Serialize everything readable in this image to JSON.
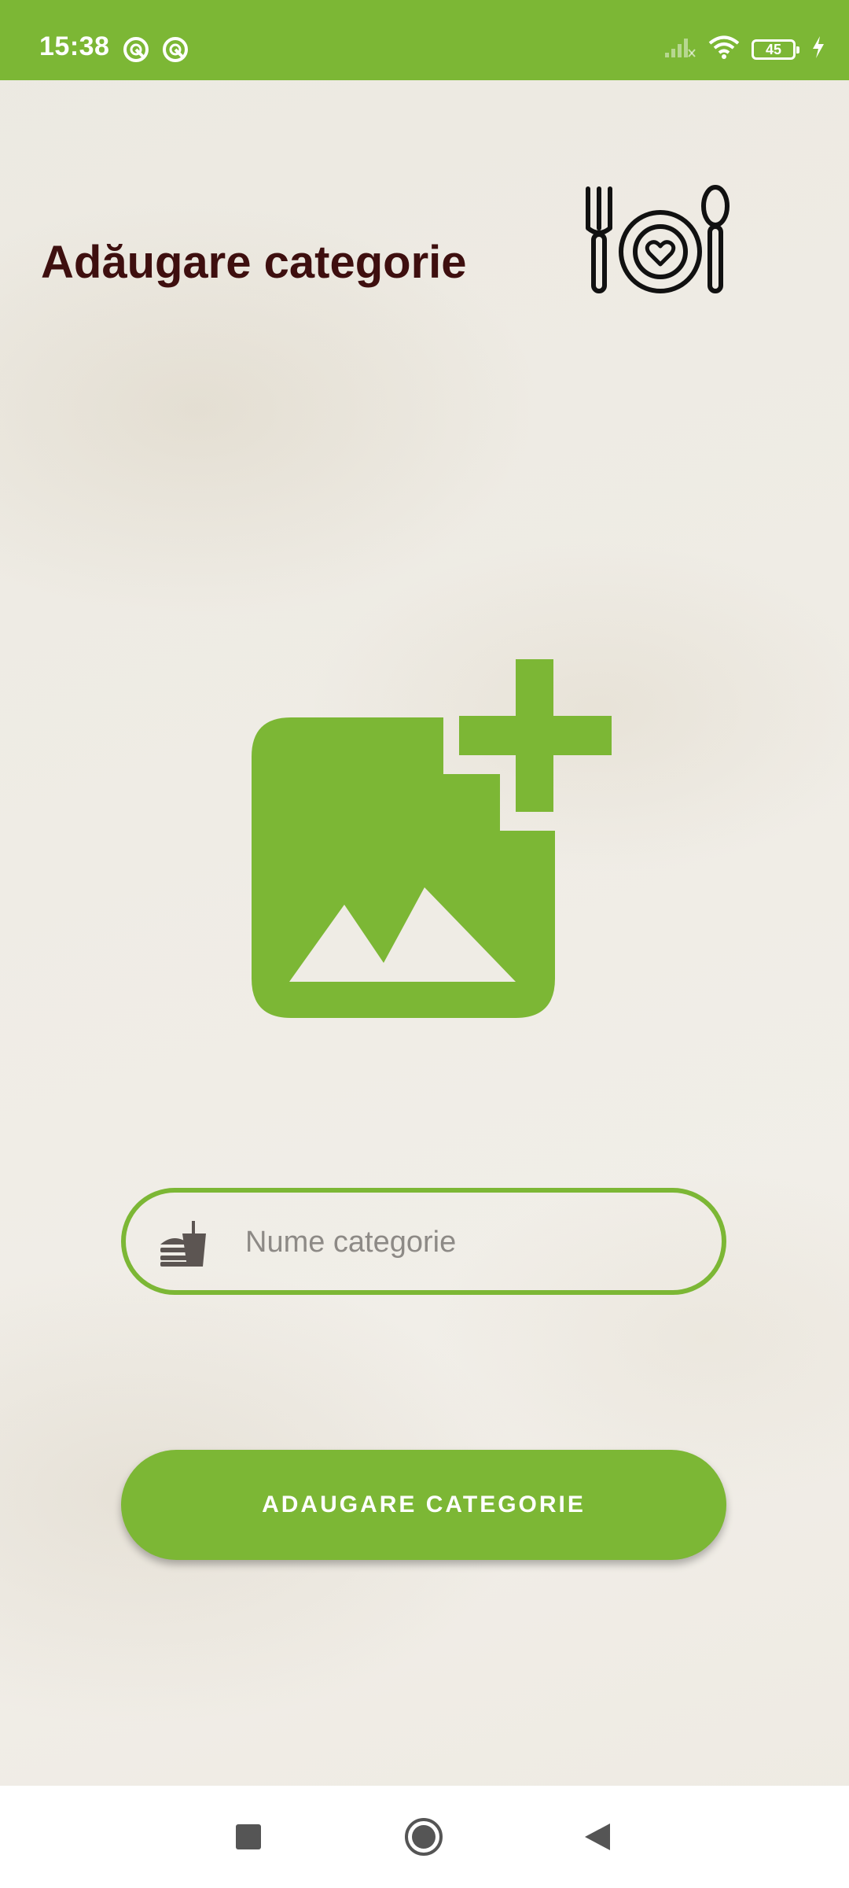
{
  "status_bar": {
    "time": "15:38",
    "battery_level": "45",
    "background_color": "#7cb735",
    "icons": [
      "notification-icon",
      "notification-icon",
      "signal-icon",
      "wifi-icon",
      "battery-icon",
      "charging-icon"
    ]
  },
  "header": {
    "title": "Adăugare categorie",
    "logo_icon": "plate-fork-spoon-heart-icon"
  },
  "main": {
    "add_image_icon": "add-photo-icon",
    "category_input": {
      "placeholder": "Nume categorie",
      "value": "",
      "icon": "fastfood-icon"
    },
    "submit_button": {
      "label": "ADAUGARE CATEGORIE"
    }
  },
  "nav_bar": {
    "buttons": [
      "recents-square-icon",
      "home-circle-icon",
      "back-triangle-icon"
    ]
  },
  "colors": {
    "accent": "#7cb735",
    "title": "#3e0f0f",
    "placeholder": "#8d8a86"
  }
}
